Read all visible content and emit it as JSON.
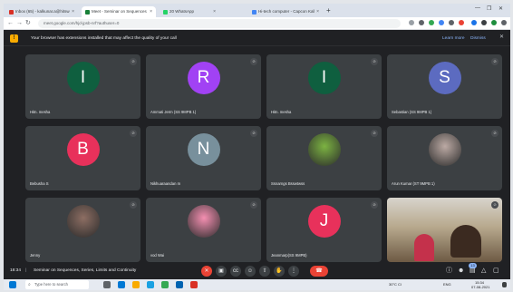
{
  "browser": {
    "tabs": [
      {
        "label": "Inbox (65) - kalkunar.a@hitsw",
        "favicon_color": "#d93025",
        "active": false
      },
      {
        "label": "Meet - Seminar on Sequences",
        "favicon_color": "#188038",
        "active": true
      },
      {
        "label": "20 WhatsApp",
        "favicon_color": "#25d366",
        "active": false
      },
      {
        "label": "Hi-tech computer - Capcon Kalk",
        "favicon_color": "#4285f4",
        "active": false
      }
    ],
    "new_tab": "+",
    "url": "meet.google.com/hjd-jpsb-nrf?authuser=0",
    "infobar_text": "Your browser has extensions installed that may affect the quality of your call",
    "infobar_link1": "Learn more",
    "infobar_link2": "Dismiss"
  },
  "participants": [
    {
      "name": "Hitn. mesha",
      "initial": "I",
      "color": "#0f5f3f",
      "type": "avatar"
    },
    {
      "name": "Ammati Jerm (SS 9MPB 1)",
      "initial": "R",
      "color": "#a142f4",
      "type": "avatar"
    },
    {
      "name": "Hitn. mesha",
      "initial": "I",
      "color": "#0f5f3f",
      "type": "avatar"
    },
    {
      "name": "Sebastian (SS 9MPB 1)",
      "initial": "S",
      "color": "#5c6bc0",
      "type": "avatar"
    },
    {
      "name": "Bebusha S",
      "initial": "B",
      "color": "#e8315b",
      "type": "avatar"
    },
    {
      "name": "Nikhuaraandan m",
      "initial": "N",
      "color": "#78909c",
      "type": "avatar"
    },
    {
      "name": "Ssnarngs Bsswtwss",
      "initial": "",
      "color": "#7cb342",
      "type": "photo"
    },
    {
      "name": "Arun Kumar (ST 9MPB 1)",
      "initial": "",
      "color": "#bcaaa4",
      "type": "photo"
    },
    {
      "name": "Jenny",
      "initial": "",
      "color": "#8d6e63",
      "type": "photo"
    },
    {
      "name": "vod Wai",
      "initial": "",
      "color": "#f48fb1",
      "type": "photo"
    },
    {
      "name": "Jeanmarp(SS 9MPB)",
      "initial": "J",
      "color": "#e8315b",
      "type": "avatar"
    },
    {
      "name": "",
      "initial": "",
      "color": "#9e8a6e",
      "type": "video"
    }
  ],
  "meeting": {
    "time": "18:34",
    "separator": "|",
    "title": "Seminar on Sequences, Series, Limits and Continuity",
    "participant_count": "13"
  },
  "controls": [
    {
      "icon": "mic-off-icon",
      "glyph": "✕",
      "red": true
    },
    {
      "icon": "camera-icon",
      "glyph": "▣",
      "red": false
    },
    {
      "icon": "captions-icon",
      "glyph": "cc",
      "red": false
    },
    {
      "icon": "emoji-icon",
      "glyph": "☺",
      "red": false
    },
    {
      "icon": "present-icon",
      "glyph": "⇧",
      "red": false
    },
    {
      "icon": "raise-hand-icon",
      "glyph": "✋",
      "red": false
    },
    {
      "icon": "more-icon",
      "glyph": "⋮",
      "red": false
    }
  ],
  "end_call_glyph": "☎",
  "right_controls": [
    {
      "icon": "info-icon",
      "glyph": "ⓘ"
    },
    {
      "icon": "people-icon",
      "glyph": "☻"
    },
    {
      "icon": "chat-icon",
      "glyph": "▤"
    },
    {
      "icon": "activities-icon",
      "glyph": "△"
    },
    {
      "icon": "lock-icon",
      "glyph": "▢"
    }
  ],
  "taskbar": {
    "search_placeholder": "Type here to search",
    "tray_temp": "30°C Cl",
    "tray_lang": "ENG",
    "clock_time": "15:34",
    "clock_date": "07-08-2021",
    "apps": [
      {
        "name": "task-view-icon",
        "color": "#5f6368"
      },
      {
        "name": "store-icon",
        "color": "#0078d4"
      },
      {
        "name": "file-explorer-icon",
        "color": "#f9ab00"
      },
      {
        "name": "edge-icon",
        "color": "#1ba1e2"
      },
      {
        "name": "chrome-icon",
        "color": "#34a853"
      },
      {
        "name": "mail-icon",
        "color": "#0063b1"
      },
      {
        "name": "app-icon",
        "color": "#d93025"
      }
    ]
  }
}
